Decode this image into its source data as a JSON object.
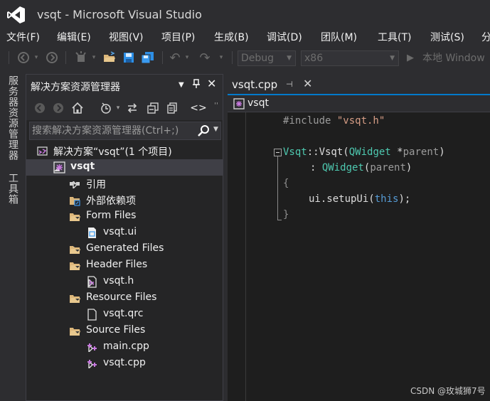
{
  "window": {
    "title": "vsqt - Microsoft Visual Studio"
  },
  "menu": [
    "文件(F)",
    "编辑(E)",
    "视图(V)",
    "项目(P)",
    "生成(B)",
    "调试(D)",
    "团队(M)",
    "工具(T)",
    "测试(S)",
    "分"
  ],
  "toolbar": {
    "config": "Debug",
    "platform": "x86",
    "run_label": "本地 Window"
  },
  "side_tabs": [
    "服务器资源管理器",
    "工具箱"
  ],
  "solution_explorer": {
    "title": "解决方案资源管理器",
    "search_placeholder": "搜索解决方案资源管理器(Ctrl+;)",
    "tree": [
      {
        "label": "解决方案“vsqt”(1 个项目)",
        "icon": "solution-icon",
        "expander": "none"
      },
      {
        "label": "vsqt",
        "icon": "qt-project-icon",
        "expander": "open",
        "bold": true,
        "selected": true
      },
      {
        "label": "引用",
        "icon": "references-icon",
        "expander": "closed"
      },
      {
        "label": "外部依赖项",
        "icon": "external-deps-icon",
        "expander": "none"
      },
      {
        "label": "Form Files",
        "icon": "filter-folder-icon",
        "expander": "open"
      },
      {
        "label": "vsqt.ui",
        "icon": "ui-file-icon",
        "expander": "none"
      },
      {
        "label": "Generated Files",
        "icon": "filter-folder-icon",
        "expander": "closed"
      },
      {
        "label": "Header Files",
        "icon": "filter-folder-icon",
        "expander": "open"
      },
      {
        "label": "vsqt.h",
        "icon": "header-file-icon",
        "expander": "closed"
      },
      {
        "label": "Resource Files",
        "icon": "filter-folder-icon",
        "expander": "open"
      },
      {
        "label": "vsqt.qrc",
        "icon": "file-icon",
        "expander": "none"
      },
      {
        "label": "Source Files",
        "icon": "filter-folder-icon",
        "expander": "open"
      },
      {
        "label": "main.cpp",
        "icon": "cpp-file-icon",
        "expander": "closed"
      },
      {
        "label": "vsqt.cpp",
        "icon": "cpp-file-icon",
        "expander": "closed"
      }
    ]
  },
  "editor": {
    "tab_label": "vsqt.cpp",
    "nav_label": "vsqt",
    "code": {
      "l1_directive": "#include ",
      "l1_string": "\"vsqt.h\"",
      "l2_class": "Vsqt",
      "l2_sep": "::",
      "l2_ctor": "Vsqt",
      "l2_open": "(",
      "l2_type": "QWidget",
      "l2_ptr": " *",
      "l2_param": "parent",
      "l2_close": ")",
      "l3_colon": ": ",
      "l3_type": "QWidget",
      "l3_open": "(",
      "l3_param": "parent",
      "l3_close": ")",
      "l4": "{",
      "l5_call": "ui.setupUi(",
      "l5_this": "this",
      "l5_end": ");",
      "l6": "}"
    }
  },
  "watermark": "CSDN @玫城狮7号"
}
